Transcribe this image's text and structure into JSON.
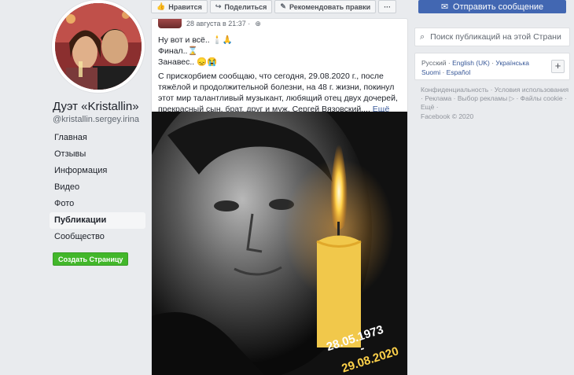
{
  "sidebar": {
    "page_title": "Дуэт «Kristallin»",
    "page_handle": "@kristallin.sergey.irina",
    "nav_items": [
      "Главная",
      "Отзывы",
      "Информация",
      "Видео",
      "Фото",
      "Публикации",
      "Сообщество"
    ],
    "active_index": 5,
    "create_page_label": "Создать Страницу"
  },
  "actions": {
    "like_label": "Нравится",
    "share_label": "Поделиться",
    "suggest_label": "Рекомендовать правки",
    "more_label": "···"
  },
  "post": {
    "timestamp": "28 августа в 21:37 ·",
    "line1": "Ну вот и всё.. 🕯️🙏",
    "line2": "Финал..⌛",
    "line3": "Занавес.. 😞😭",
    "body": "С прискорбием сообщаю, что сегодня, 29.08.2020 г., после тяжёлой и продолжительной болезни, на 48 г. жизни, покинул этот мир талантливый музыкант, любящий отец двух дочерей, прекрасный сын, брат, друг и муж, Сергей Вязовский....",
    "more_link": "Ещё",
    "image_date_birth": "28.05.1973",
    "image_dash": "-",
    "image_date_death": "29.08.2020"
  },
  "right": {
    "send_message_label": "Отправить сообщение",
    "search_placeholder": "Поиск публикаций на этой Страни",
    "lang_current": "Русский",
    "lang_links": [
      "English (UK)",
      "Українська",
      "Suomi",
      "Español"
    ],
    "lang_separator": " · ",
    "lang_plus": "+",
    "footer_links": "Конфиденциальность · Условия использования · Реклама · Выбор рекламы ▷ · Файлы cookie · Ещё ·",
    "footer_copy": "Facebook © 2020"
  },
  "colors": {
    "accent": "#4267b2",
    "create_button": "#42b72a",
    "link": "#385898"
  }
}
